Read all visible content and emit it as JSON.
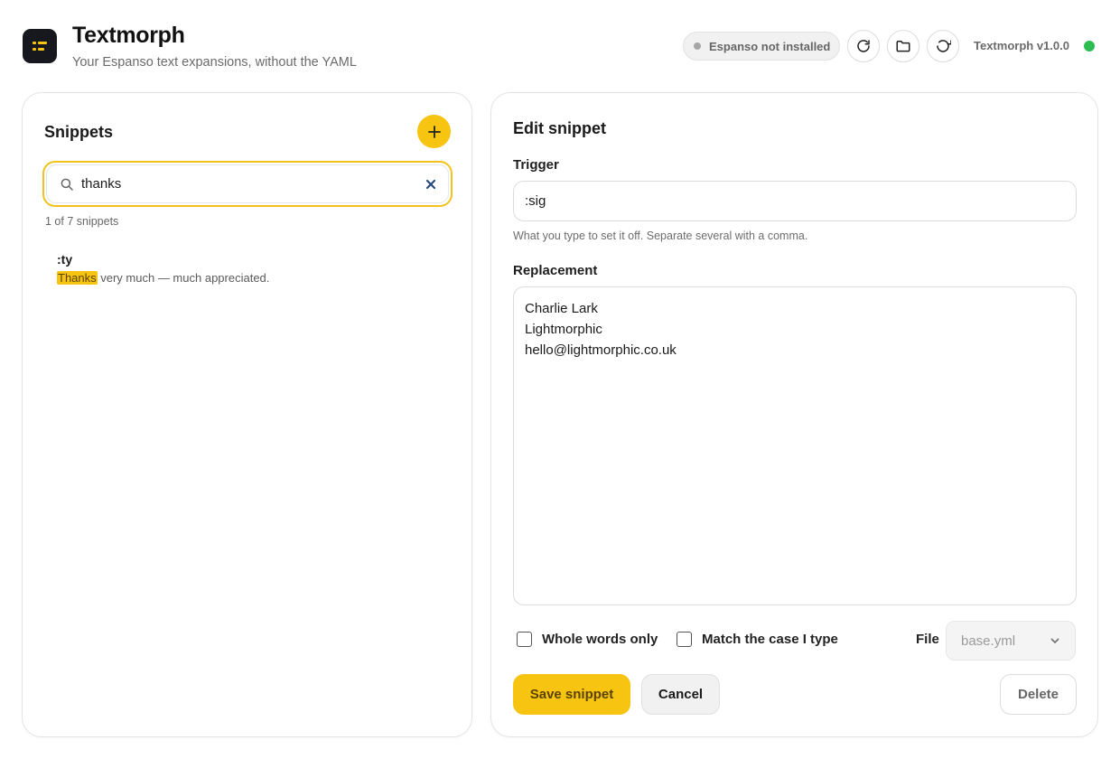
{
  "app": {
    "title": "Textmorph",
    "subtitle": "Your Espanso text expansions, without the YAML",
    "status": "Espanso not installed",
    "version": "Textmorph v1.0.0"
  },
  "header_icons": [
    "refresh-icon",
    "folder-icon",
    "reload-icon"
  ],
  "colors": {
    "accent": "#f6c411",
    "online": "#2ebd52",
    "logo_bg": "#17181d"
  },
  "snippets": {
    "title": "Snippets",
    "search_value": "thanks",
    "count_text": "1 of 7 snippets",
    "items": [
      {
        "trigger": ":ty",
        "highlight": "Thanks",
        "preview_rest": " very much — much appreciated."
      }
    ]
  },
  "editor": {
    "title": "Edit snippet",
    "trigger_label": "Trigger",
    "trigger_value": ":sig",
    "trigger_help": "What you type to set it off. Separate several with a comma.",
    "replacement_label": "Replacement",
    "replacement_value": "Charlie Lark\nLightmorphic\nhello@lightmorphic.co.uk",
    "whole_words_label": "Whole words only",
    "match_case_label": "Match the case I type",
    "file_label": "File",
    "file_value": "base.yml",
    "save_label": "Save snippet",
    "cancel_label": "Cancel",
    "delete_label": "Delete"
  }
}
